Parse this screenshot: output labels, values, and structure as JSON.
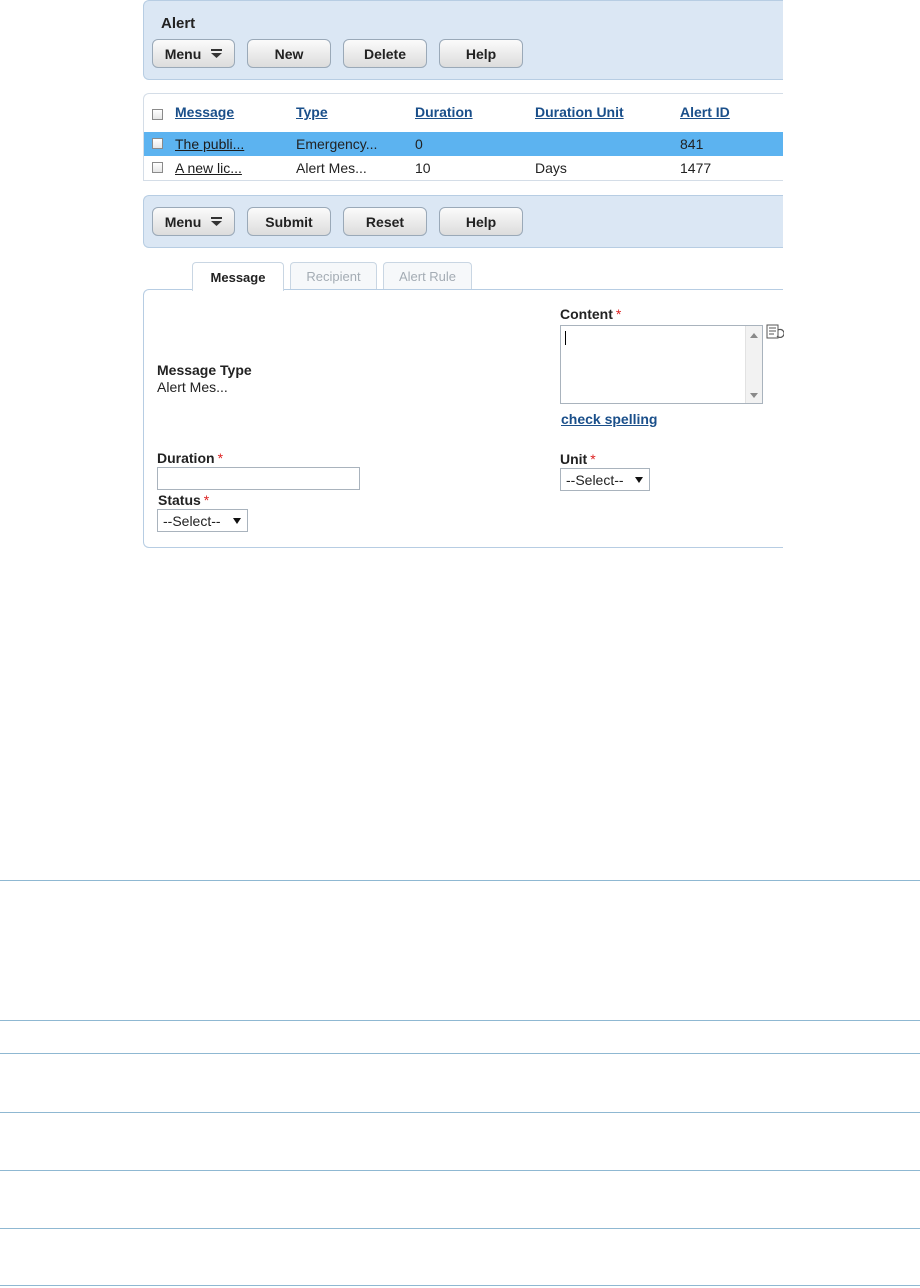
{
  "toolbar_top": {
    "title": "Alert",
    "buttons": {
      "menu": "Menu",
      "new": "New",
      "delete": "Delete",
      "help": "Help"
    }
  },
  "grid": {
    "columns": [
      "Message",
      "Type",
      "Duration",
      "Duration Unit",
      "Alert ID"
    ],
    "rows": [
      {
        "message": "The publi...",
        "type": "Emergency...",
        "duration": "0",
        "unit": "",
        "alert_id": "841",
        "selected": true
      },
      {
        "message": "A new lic...",
        "type": "Alert Mes...",
        "duration": "10",
        "unit": "Days",
        "alert_id": "1477",
        "selected": false
      }
    ]
  },
  "toolbar_mid": {
    "buttons": {
      "menu": "Menu",
      "submit": "Submit",
      "reset": "Reset",
      "help": "Help"
    }
  },
  "tabs": [
    "Message",
    "Recipient",
    "Alert Rule"
  ],
  "form": {
    "message_type_label": "Message Type",
    "message_type_value": "Alert Mes...",
    "content_label": "Content",
    "required_mark": "*",
    "check_spelling": "check spelling",
    "duration_label": "Duration",
    "status_label": "Status",
    "status_value": "--Select--",
    "unit_label": "Unit",
    "unit_value": "--Select--"
  },
  "colors": {
    "selected_row": "#5cb3f0",
    "toolbar_bg": "#dbe7f4",
    "link": "#1a4f8a",
    "required": "#dd2222"
  },
  "icons": [
    "chevron-down-menu-icon",
    "document-icon"
  ]
}
